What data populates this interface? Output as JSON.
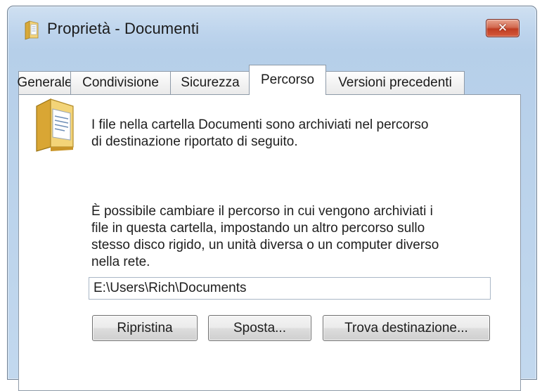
{
  "window": {
    "title": "Proprietà - Documenti",
    "close_label": "✕"
  },
  "tabs": [
    {
      "label": "Generale",
      "active": false
    },
    {
      "label": "Condivisione",
      "active": false
    },
    {
      "label": "Sicurezza",
      "active": false
    },
    {
      "label": "Percorso",
      "active": true
    },
    {
      "label": "Versioni precedenti",
      "active": false
    }
  ],
  "panel": {
    "intro_lines": [
      "I file nella cartella Documenti sono archiviati nel percorso",
      "di destinazione riportato di seguito."
    ],
    "info_lines": [
      "È possibile cambiare il percorso in cui vengono archiviati i",
      "file in questa cartella, impostando un altro percorso sullo",
      "stesso disco rigido, un unità diversa o un computer diverso",
      "nella rete."
    ],
    "path_value": "E:\\Users\\Rich\\Documents"
  },
  "buttons": {
    "restore": "Ripristina",
    "move": "Sposta...",
    "find_target": "Trova destinazione..."
  },
  "icons": {
    "title": "folder-icon",
    "panel": "documents-folder-icon",
    "close": "close-icon"
  },
  "colors": {
    "titlebar": "#bcd3ec",
    "close_button": "#c8452a"
  }
}
